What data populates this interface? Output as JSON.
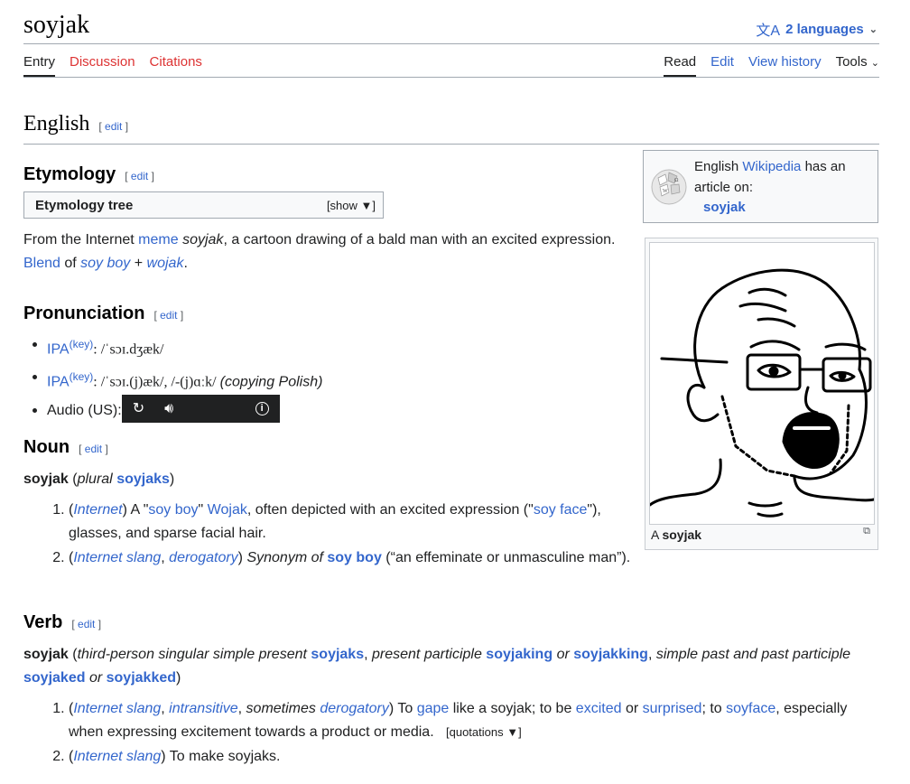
{
  "page": {
    "title": "soyjak",
    "languages_label": "2 languages"
  },
  "tabs_left": [
    {
      "label": "Entry"
    },
    {
      "label": "Discussion"
    },
    {
      "label": "Citations"
    }
  ],
  "tabs_right": [
    {
      "label": "Read"
    },
    {
      "label": "Edit"
    },
    {
      "label": "View history"
    },
    {
      "label": "Tools"
    }
  ],
  "edit_label": "edit",
  "english": {
    "heading": "English"
  },
  "etymology": {
    "heading": "Etymology",
    "tree_title": "Etymology tree",
    "tree_toggle": "[show ▼]",
    "text1_a": "From the Internet ",
    "text1_link": "meme",
    "text1_b": " ",
    "text1_i": "soyjak",
    "text1_c": ", a cartoon drawing of a bald man with an excited expression.",
    "text2_link": "Blend",
    "text2_of": " of ",
    "text2_a": "soy boy",
    "text2_plus": " + ",
    "text2_b": "wojak",
    "text2_end": "."
  },
  "pronunciation": {
    "heading": "Pronunciation",
    "ipa_label": "IPA",
    "key_label": "(key)",
    "ipa1": ": /ˈsɔɪ.dʒæk/",
    "ipa2": ": /ˈsɔɪ.(j)æk/, /-(j)ɑːk/ ",
    "ipa2_note": "(copying Polish)",
    "audio_label": "Audio (US):",
    "player_icons": [
      "replay-icon",
      "volume-icon",
      "info-icon"
    ]
  },
  "noun": {
    "heading": "Noun",
    "headword": "soyjak",
    "plural_label": "plural",
    "plural_form": "soyjaks",
    "defs": [
      {
        "tag": "Internet",
        "a": " A \"",
        "link1": "soy boy",
        "b": "\" ",
        "link2": "Wojak",
        "c": ", often depicted with an excited expression (\"",
        "link3": "soy face",
        "d": "\"), glasses, and sparse facial hair."
      },
      {
        "tag1": "Internet slang",
        "tag2": "derogatory",
        "syn_label": " Synonym of ",
        "syn": "soy boy",
        "gloss": " (“an effeminate or unmasculine man”)."
      }
    ]
  },
  "verb": {
    "heading": "Verb",
    "headword": "soyjak",
    "f_label1": "third-person singular simple present",
    "f1": "soyjaks",
    "f_label2": "present participle",
    "f2": "soyjaking",
    "or": "or",
    "f3": "soyjakking",
    "f_label3": "simple past and past participle",
    "f4": "soyjaked",
    "f5": "soyjakked",
    "defs": [
      {
        "tag1": "Internet slang",
        "tag2": "intransitive",
        "sometimes": "sometimes",
        "tag3": "derogatory",
        "a": " To ",
        "l1": "gape",
        "b": " like a soyjak; to be ",
        "l2": "excited",
        "c": " or ",
        "l3": "surprised",
        "d": "; to ",
        "l4": "soyface",
        "e": ", especially when expressing excitement towards a product or media.",
        "quotations": "[quotations ▼]"
      },
      {
        "tag": "Internet slang",
        "text": " To make soyjaks."
      }
    ]
  },
  "sidebar": {
    "wp_text1": "English ",
    "wp_link": "Wikipedia",
    "wp_text2": " has an article on:",
    "wp_article": "soyjak",
    "caption_a": "A ",
    "caption_b": "soyjak"
  }
}
